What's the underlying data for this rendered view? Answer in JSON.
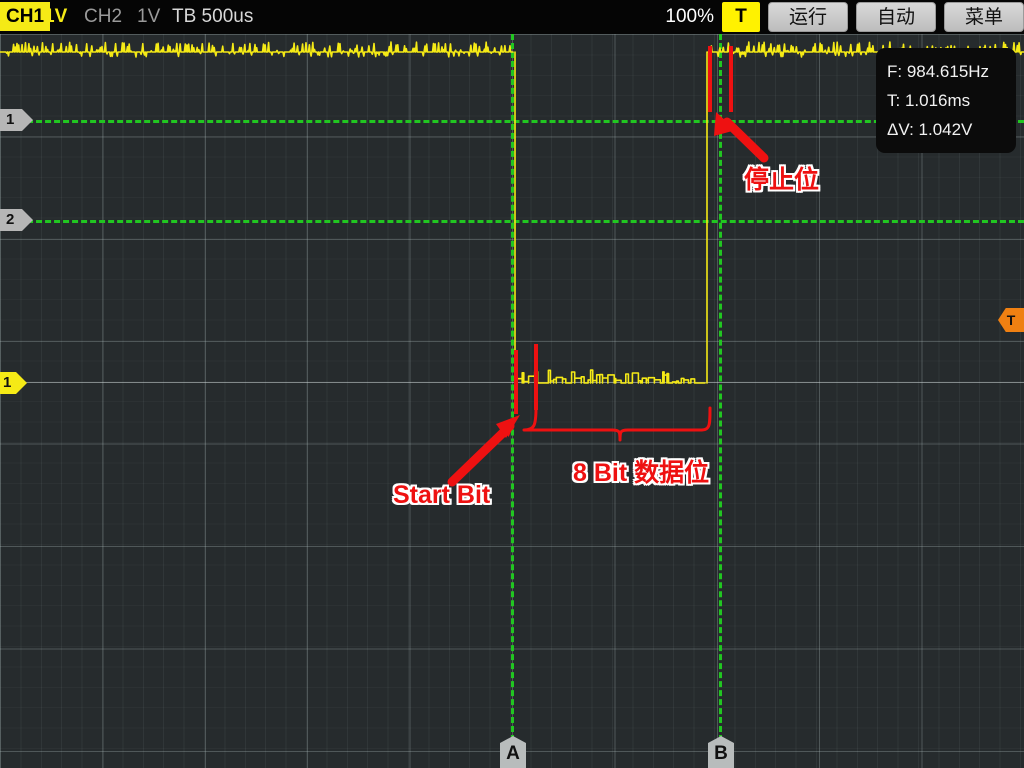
{
  "topbar": {
    "ch1_badge": "CH1",
    "ch1_volts": "1V",
    "ch2_label": "CH2",
    "ch2_volts": "1V",
    "timebase": "TB 500us",
    "zoom": "100%",
    "trigger_button": "T",
    "run_button": "运行",
    "auto_button": "自动",
    "menu_button": "菜单",
    "accent_yellow": "#f5ea16",
    "button_gray": "#c9c9c9"
  },
  "measurements": {
    "frequency": "F: 984.615Hz",
    "period": "T: 1.016ms",
    "delta_v": "ΔV: 1.042V"
  },
  "channel_markers": [
    {
      "label": "1",
      "color": "#b6b6b6"
    },
    {
      "label": "2",
      "color": "#b6b6b6"
    },
    {
      "label": "1",
      "color": "#f5ea16"
    }
  ],
  "cursors": {
    "a_label": "A",
    "b_label": "B",
    "trigger_label": "T",
    "cursor_color": "#21c621",
    "trigger_color": "#ef8012"
  },
  "annotations": {
    "start_bit": "Start Bit",
    "data_bits": "8 Bit 数据位",
    "stop_bit": "停止位",
    "color": "#ee1111"
  },
  "waveform": {
    "trace_color": "#f5ea16",
    "idle_high_level": "1V",
    "channel": "CH1"
  }
}
